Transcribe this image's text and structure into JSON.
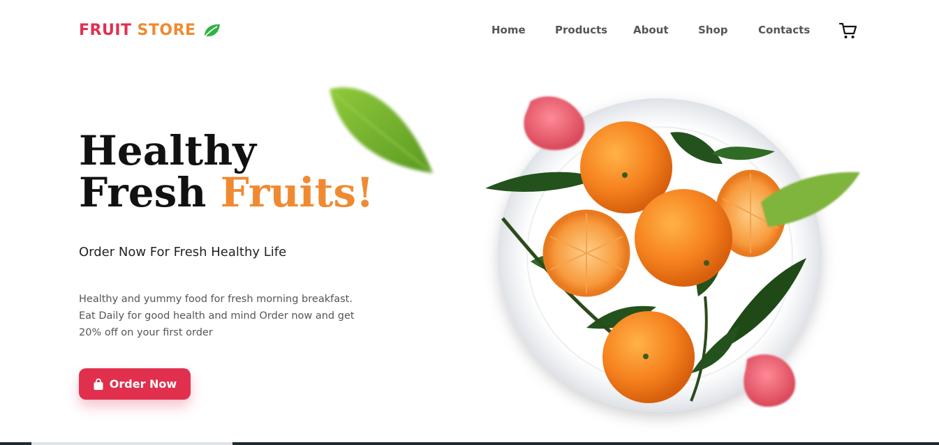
{
  "brand": {
    "word1": "FRUIT",
    "word2": "STORE",
    "icon": "leaf-icon",
    "color1": "#e0304e",
    "color2": "#f08a32",
    "icon_color": "#2fb344"
  },
  "nav": {
    "items": [
      {
        "label": "Home"
      },
      {
        "label": "Products"
      },
      {
        "label": "About"
      },
      {
        "label": "Shop"
      },
      {
        "label": "Contacts"
      }
    ],
    "cart_icon": "cart-icon"
  },
  "hero": {
    "title_line1": "Healthy",
    "title_line2a": "Fresh",
    "title_line2b": "Fruits!",
    "subtitle": "Order Now For Fresh Healthy Life",
    "description": "Healthy and yummy food for fresh morning breakfast. Eat Daily for good health and mind Order now and get 20% off on your first order",
    "button_label": "Order Now",
    "button_icon": "shopping-bag-icon"
  },
  "colors": {
    "accent": "#f08a32",
    "primary": "#e0304e",
    "heading": "#111111"
  }
}
